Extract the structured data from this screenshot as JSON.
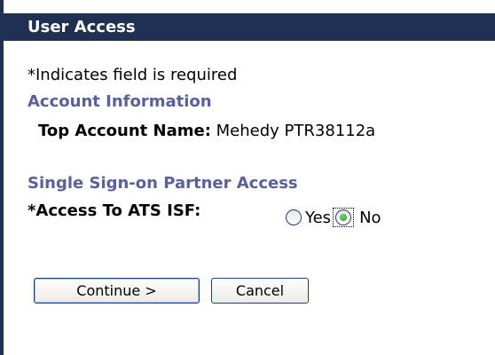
{
  "window": {
    "title": "User Access"
  },
  "form": {
    "required_note": "*Indicates field is required",
    "account_section": {
      "heading": "Account Information",
      "top_account_label": "Top Account Name:",
      "top_account_value": "Mehedy PTR38112a"
    },
    "sso_section": {
      "heading": "Single Sign-on Partner Access",
      "access_label": "*Access To ATS ISF:",
      "options": [
        {
          "label": "Yes",
          "selected": false
        },
        {
          "label": "No",
          "selected": true
        }
      ]
    }
  },
  "buttons": {
    "continue_label": "Continue >",
    "cancel_label": "Cancel"
  },
  "colors": {
    "title_bar": "#1f3052",
    "section_heading": "#5a5fa0",
    "radio_selected": "#21a121",
    "button_border": "#1e3e78"
  },
  "icons": {
    "radio_unselected": "radio-unchecked-icon",
    "radio_selected": "radio-checked-icon"
  }
}
